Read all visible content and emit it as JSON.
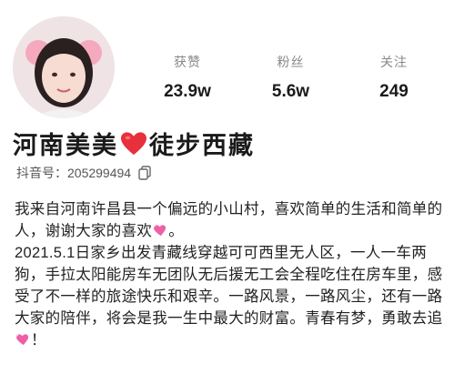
{
  "profile": {
    "name_part1": "河南美美",
    "name_part2": "徒步西藏",
    "id_label": "抖音号：",
    "id_value": "205299494"
  },
  "stats": [
    {
      "label": "获赞",
      "value": "23.9w"
    },
    {
      "label": "粉丝",
      "value": "5.6w"
    },
    {
      "label": "关注",
      "value": "249"
    }
  ],
  "bio": {
    "line1_text": "我来自河南许昌县一个偏远的小山村，喜欢简单的生活和简单的人，谢谢大家的喜欢",
    "line1_end": "。",
    "line2_text": "2021.5.1日家乡出发青藏线穿越可可西里无人区，一人一车两狗，手拉太阳能房车无团队无后援无工会全程吃住在房车里，感受了不一样的旅途快乐和艰辛。一路风景，一路风尘，还有一路大家的陪伴，将会是我一生中最大的财富。青春有梦，勇敢去追",
    "line2_end": "！"
  },
  "icons": {
    "name_heart": "red-heart-icon",
    "bio_heart": "pink-sparkle-heart-icon",
    "copy": "copy-icon"
  },
  "colors": {
    "heart_red": "#e8303c",
    "heart_pink": "#ee5fa8",
    "label_gray": "#888888"
  }
}
